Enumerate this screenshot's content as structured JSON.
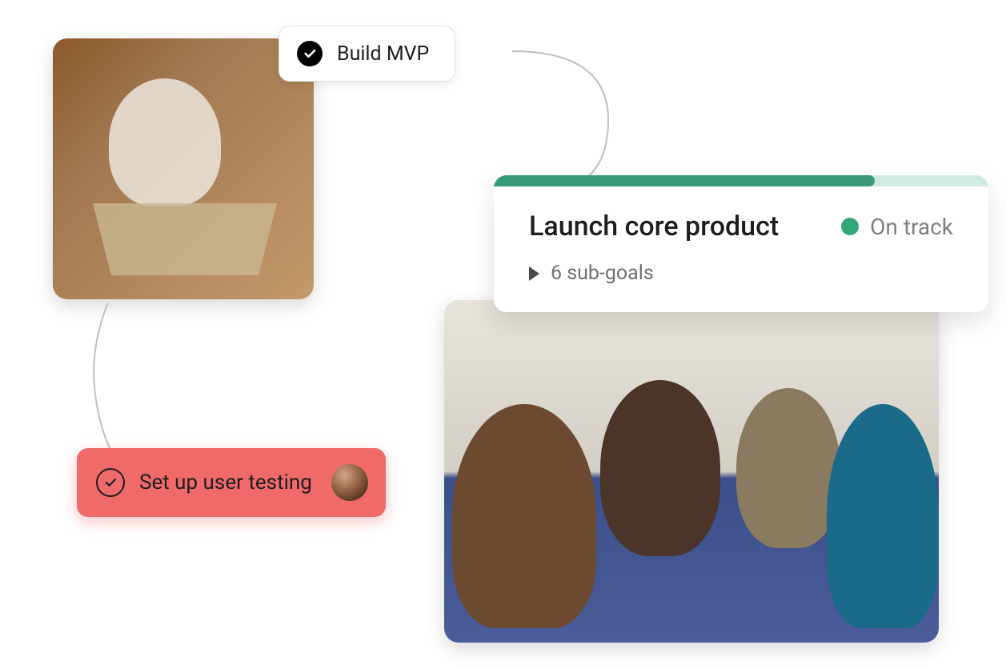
{
  "tasks": {
    "mvp": {
      "label": "Build MVP",
      "completed": true
    },
    "testing": {
      "label": "Set up user testing",
      "assignee": "user-avatar"
    }
  },
  "goal": {
    "title": "Launch core product",
    "status_label": "On track",
    "status_color": "#32a879",
    "progress_percent": 77,
    "subgoals_label": "6 sub-goals",
    "subgoals_count": 6
  }
}
